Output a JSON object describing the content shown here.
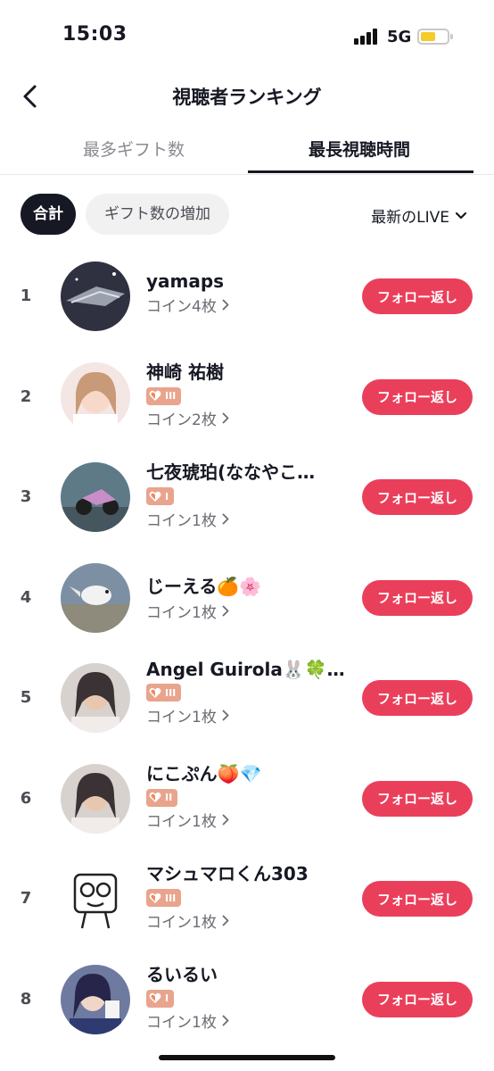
{
  "status_bar": {
    "time": "15:03",
    "network": "5G"
  },
  "nav": {
    "title": "視聴者ランキング"
  },
  "tabs": [
    {
      "label": "最多ギフト数",
      "active": false
    },
    {
      "label": "最長視聴時間",
      "active": true
    }
  ],
  "filters": {
    "chips": [
      {
        "label": "合計",
        "selected": true
      },
      {
        "label": "ギフト数の増加",
        "selected": false
      }
    ],
    "sort_label": "最新のLIVE"
  },
  "follow_label": "フォロー返し",
  "viewers": [
    {
      "rank": "1",
      "name": "yamaps",
      "coins": "コイン4枚",
      "badge": null,
      "avatar_icon": "space-scene-avatar"
    },
    {
      "rank": "2",
      "name": "神崎 祐樹",
      "coins": "コイン2枚",
      "badge": "III",
      "avatar_icon": "photo-avatar"
    },
    {
      "rank": "3",
      "name": "七夜琥珀(ななやこ…",
      "coins": "コイン1枚",
      "badge": "I",
      "avatar_icon": "motorcycle-avatar"
    },
    {
      "rank": "4",
      "name": "じーえる🍊🌸",
      "coins": "コイン1枚",
      "badge": null,
      "avatar_icon": "bird-avatar"
    },
    {
      "rank": "5",
      "name": "Angel Guirola🐰🍀…",
      "coins": "コイン1枚",
      "badge": "III",
      "avatar_icon": "portrait-avatar"
    },
    {
      "rank": "6",
      "name": "にこぷん🍑💎",
      "coins": "コイン1枚",
      "badge": "II",
      "avatar_icon": "portrait-avatar"
    },
    {
      "rank": "7",
      "name": "マシュマロくん303",
      "coins": "コイン1枚",
      "badge": "III",
      "avatar_icon": "doodle-avatar"
    },
    {
      "rank": "8",
      "name": "るいるい",
      "coins": "コイン1枚",
      "badge": "I",
      "avatar_icon": "cosplay-avatar"
    }
  ],
  "colors": {
    "accent": "#ea3f5b",
    "badge": "#e9a48d",
    "text": "#161823",
    "muted": "#8a8b91"
  }
}
